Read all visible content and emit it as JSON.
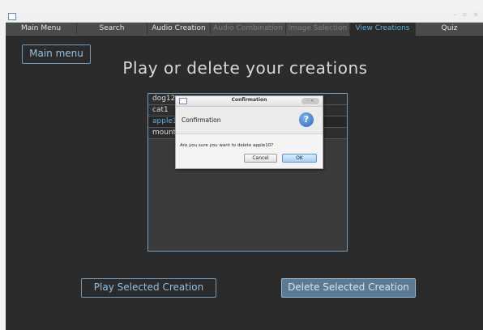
{
  "window": {
    "controls": "– ▫ ×"
  },
  "tabs": [
    {
      "label": "Main Menu",
      "state": "normal"
    },
    {
      "label": "Search",
      "state": "normal"
    },
    {
      "label": "Audio Creation",
      "state": "normal"
    },
    {
      "label": "Audio Combination",
      "state": "disabled"
    },
    {
      "label": "Image Selection",
      "state": "disabled"
    },
    {
      "label": "View Creations",
      "state": "active"
    },
    {
      "label": "Quiz",
      "state": "normal"
    }
  ],
  "main_menu_button": "Main menu",
  "heading": "Play or delete your creations",
  "creations": [
    {
      "label": "dog12",
      "selected": false
    },
    {
      "label": "cat1",
      "selected": false
    },
    {
      "label": "apple10",
      "selected": true
    },
    {
      "label": "mountain",
      "selected": false
    }
  ],
  "play_button": "Play Selected Creation",
  "delete_button": "Delete Selected Creation",
  "dialog": {
    "title": "Confirmation",
    "controls": "– ×",
    "header": "Confirmation",
    "help_glyph": "?",
    "content": "Are you sure you want to delete apple10?",
    "cancel": "Cancel",
    "ok": "OK"
  },
  "colors": {
    "background": "#2b2b2b",
    "accent": "#58b3e6",
    "outline": "#6f9bbd"
  }
}
